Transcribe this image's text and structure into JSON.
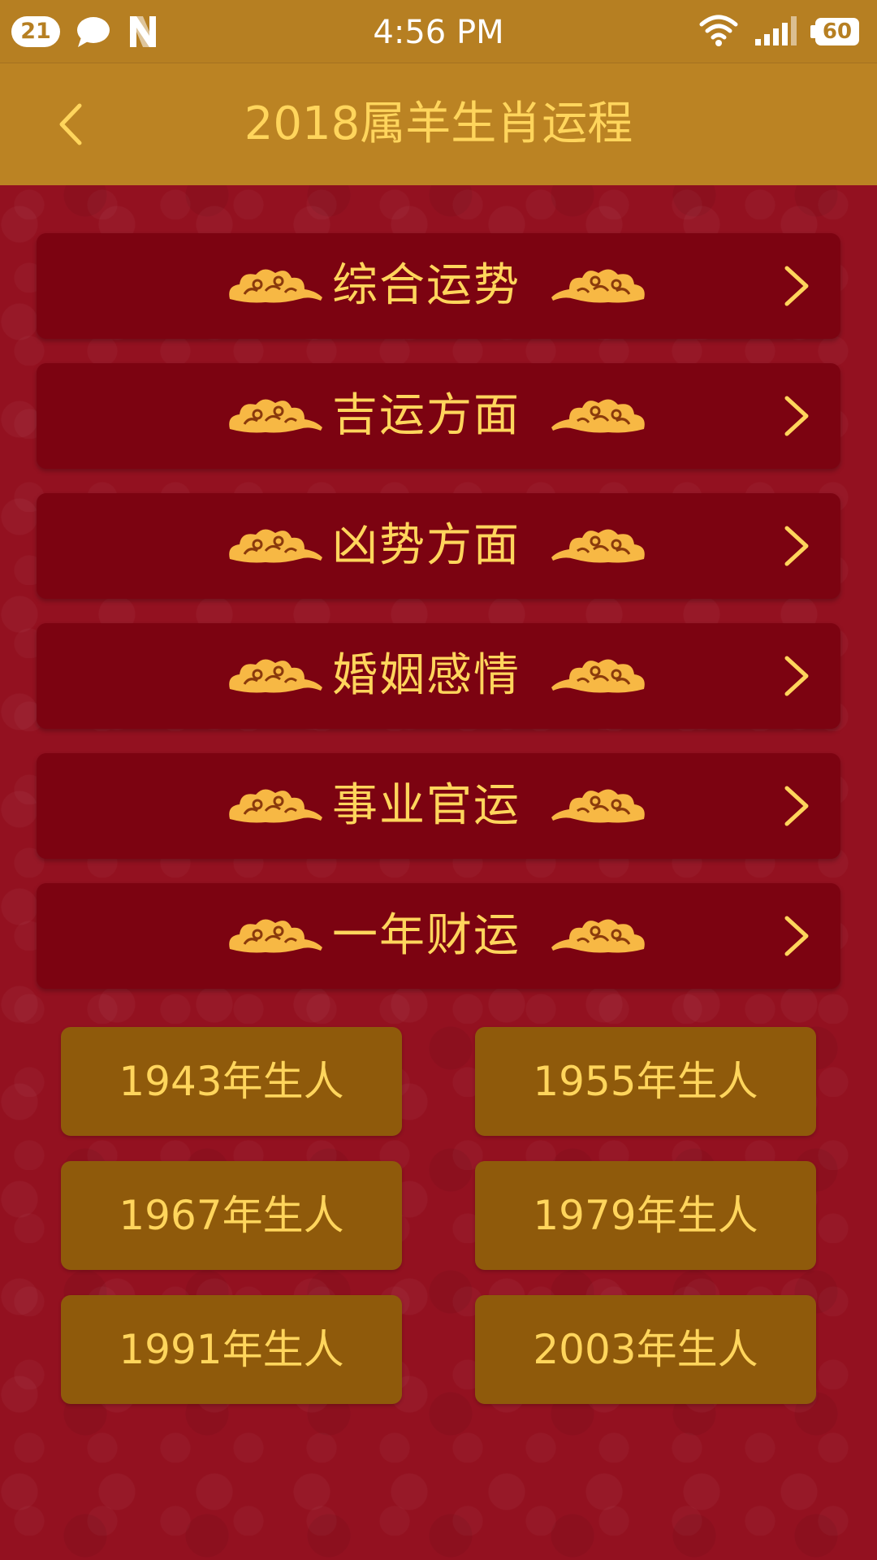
{
  "status_bar": {
    "notification_count": "21",
    "time": "4:56 PM",
    "battery": "60",
    "icons": [
      "chat-bubble-icon",
      "n-app-icon",
      "wifi-icon",
      "signal-icon",
      "battery-icon"
    ]
  },
  "header": {
    "title": "2018属羊生肖运程",
    "back_icon": "chevron-left-icon"
  },
  "menu": {
    "items": [
      {
        "label": "综合运势"
      },
      {
        "label": "吉运方面"
      },
      {
        "label": "凶势方面"
      },
      {
        "label": "婚姻感情"
      },
      {
        "label": "事业官运"
      },
      {
        "label": "一年财运"
      }
    ]
  },
  "years": {
    "buttons": [
      {
        "label": "1943年生人"
      },
      {
        "label": "1955年生人"
      },
      {
        "label": "1967年生人"
      },
      {
        "label": "1979年生人"
      },
      {
        "label": "1991年生人"
      },
      {
        "label": "2003年生人"
      }
    ]
  },
  "colors": {
    "background": "#931120",
    "header": "#bb8323",
    "status_bar": "#b67f22",
    "menu_item": "#7c0311",
    "year_button": "#8f5a0b",
    "gold_text": "#ffd55c"
  }
}
